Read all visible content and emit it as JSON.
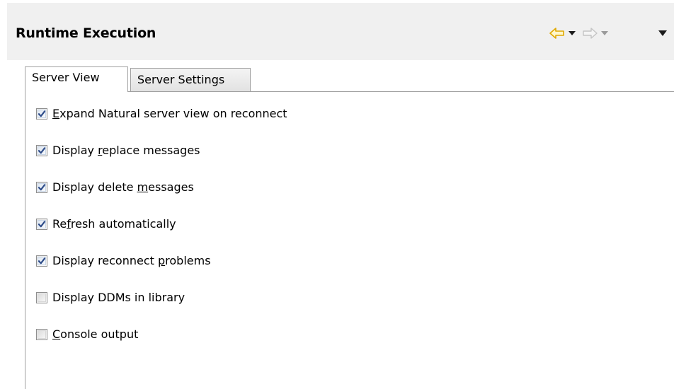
{
  "header": {
    "title": "Runtime Execution"
  },
  "toolbar": {
    "back_icon": "back-arrow-icon",
    "back_menu_icon": "chevron-down-icon",
    "forward_icon": "forward-arrow-icon",
    "forward_menu_icon": "chevron-down-icon",
    "view_menu_icon": "chevron-down-icon",
    "accent_color": "#e8b400",
    "disabled_color": "#c8c8c8"
  },
  "tabs": [
    {
      "label": "Server View",
      "selected": true
    },
    {
      "label": "Server Settings",
      "selected": false
    }
  ],
  "options": [
    {
      "prefix": "",
      "mnemonic": "E",
      "suffix": "xpand Natural server view on reconnect",
      "checked": true
    },
    {
      "prefix": "Display ",
      "mnemonic": "r",
      "suffix": "eplace messages",
      "checked": true
    },
    {
      "prefix": "Display delete ",
      "mnemonic": "m",
      "suffix": "essages",
      "checked": true
    },
    {
      "prefix": "Re",
      "mnemonic": "f",
      "suffix": "resh automatically",
      "checked": true
    },
    {
      "prefix": "Display reconnect ",
      "mnemonic": "p",
      "suffix": "roblems",
      "checked": true
    },
    {
      "prefix": "Display DDMs in library",
      "mnemonic": "",
      "suffix": "",
      "checked": false
    },
    {
      "prefix": "",
      "mnemonic": "C",
      "suffix": "onsole output",
      "checked": false
    }
  ],
  "colors": {
    "header_bg": "#f0f0f0",
    "check_mark": "#2f4d8a",
    "border": "#a0a0a0"
  }
}
